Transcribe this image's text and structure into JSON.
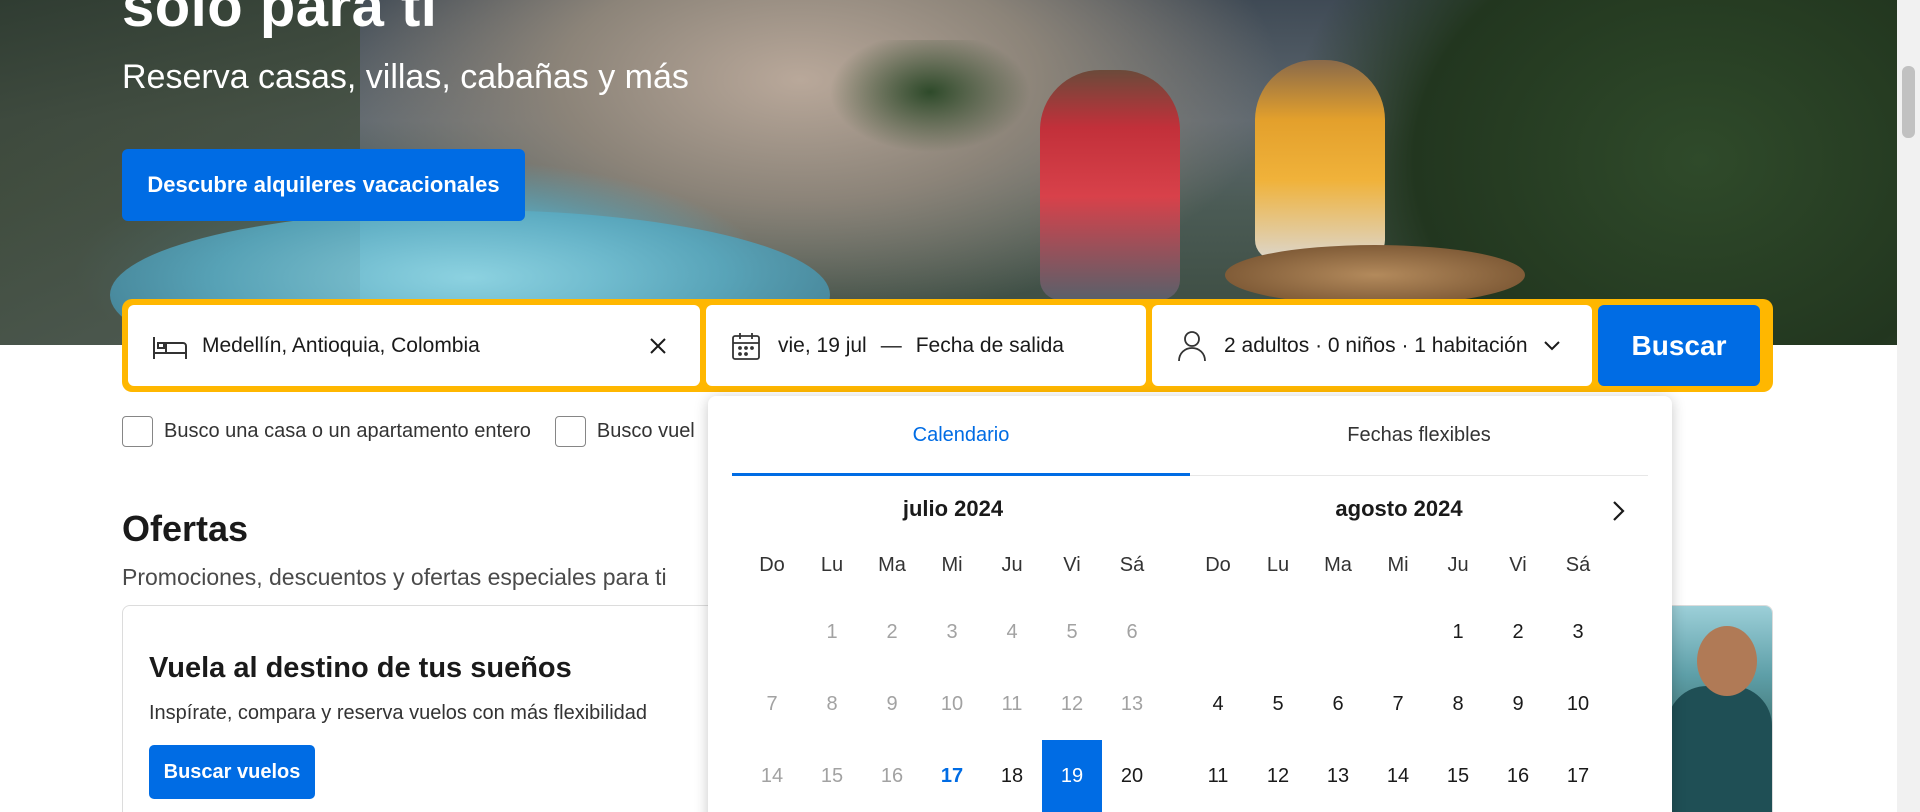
{
  "hero": {
    "title": "solo para ti",
    "subtitle": "Reserva casas, villas, cabañas y más",
    "cta_label": "Descubre alquileres vacacionales"
  },
  "search": {
    "destination": "Medellín, Antioquia, Colombia",
    "checkin": "vie, 19 jul",
    "separator": "—",
    "checkout": "Fecha de salida",
    "guests": "2 adultos · 0 niños · 1 habitación",
    "button_label": "Buscar"
  },
  "filters": {
    "entire_home_label": "Busco una casa o un apartamento entero",
    "flights_label": "Busco vuel"
  },
  "offers": {
    "title": "Ofertas",
    "subtitle": "Promociones, descuentos y ofertas especiales para ti",
    "card": {
      "title": "Vuela al destino de tus sueños",
      "text": "Inspírate, compara y reserva vuelos con más flexibilidad",
      "button_label": "Buscar vuelos"
    }
  },
  "calendar": {
    "tabs": [
      {
        "label": "Calendario",
        "active": true
      },
      {
        "label": "Fechas flexibles",
        "active": false
      }
    ],
    "weekdays": [
      "Do",
      "Lu",
      "Ma",
      "Mi",
      "Ju",
      "Vi",
      "Sá"
    ],
    "months": [
      {
        "title": "julio 2024",
        "days": [
          "",
          "1",
          "2",
          "3",
          "4",
          "5",
          "6",
          "7",
          "8",
          "9",
          "10",
          "11",
          "12",
          "13",
          "14",
          "15",
          "16",
          "17",
          "18",
          "19",
          "20"
        ],
        "past_until": "16",
        "today": "17",
        "selected": "19"
      },
      {
        "title": "agosto 2024",
        "days": [
          "",
          "",
          "",
          "",
          "1",
          "2",
          "3",
          "4",
          "5",
          "6",
          "7",
          "8",
          "9",
          "10",
          "11",
          "12",
          "13",
          "14",
          "15",
          "16",
          "17"
        ],
        "past_until": "",
        "today": "",
        "selected": ""
      }
    ]
  },
  "colors": {
    "brand_blue": "#006ce4",
    "search_border": "#ffb700"
  },
  "icons": {
    "destination": "bed-icon",
    "clear": "close-icon",
    "dates": "calendar-icon",
    "guests": "person-icon",
    "dropdown": "chevron-down-icon",
    "next_month": "chevron-right-icon"
  }
}
